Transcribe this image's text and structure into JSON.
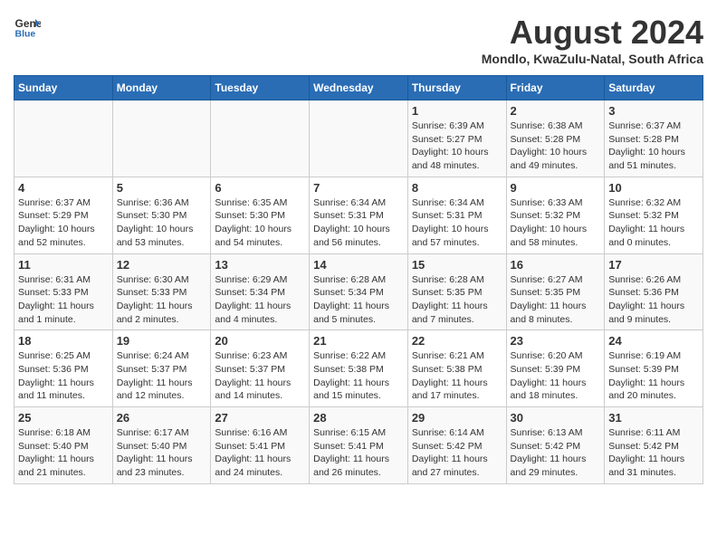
{
  "header": {
    "logo_line1": "General",
    "logo_line2": "Blue",
    "month_title": "August 2024",
    "location": "Mondlo, KwaZulu-Natal, South Africa"
  },
  "days_of_week": [
    "Sunday",
    "Monday",
    "Tuesday",
    "Wednesday",
    "Thursday",
    "Friday",
    "Saturday"
  ],
  "weeks": [
    [
      {
        "num": "",
        "info": ""
      },
      {
        "num": "",
        "info": ""
      },
      {
        "num": "",
        "info": ""
      },
      {
        "num": "",
        "info": ""
      },
      {
        "num": "1",
        "info": "Sunrise: 6:39 AM\nSunset: 5:27 PM\nDaylight: 10 hours\nand 48 minutes."
      },
      {
        "num": "2",
        "info": "Sunrise: 6:38 AM\nSunset: 5:28 PM\nDaylight: 10 hours\nand 49 minutes."
      },
      {
        "num": "3",
        "info": "Sunrise: 6:37 AM\nSunset: 5:28 PM\nDaylight: 10 hours\nand 51 minutes."
      }
    ],
    [
      {
        "num": "4",
        "info": "Sunrise: 6:37 AM\nSunset: 5:29 PM\nDaylight: 10 hours\nand 52 minutes."
      },
      {
        "num": "5",
        "info": "Sunrise: 6:36 AM\nSunset: 5:30 PM\nDaylight: 10 hours\nand 53 minutes."
      },
      {
        "num": "6",
        "info": "Sunrise: 6:35 AM\nSunset: 5:30 PM\nDaylight: 10 hours\nand 54 minutes."
      },
      {
        "num": "7",
        "info": "Sunrise: 6:34 AM\nSunset: 5:31 PM\nDaylight: 10 hours\nand 56 minutes."
      },
      {
        "num": "8",
        "info": "Sunrise: 6:34 AM\nSunset: 5:31 PM\nDaylight: 10 hours\nand 57 minutes."
      },
      {
        "num": "9",
        "info": "Sunrise: 6:33 AM\nSunset: 5:32 PM\nDaylight: 10 hours\nand 58 minutes."
      },
      {
        "num": "10",
        "info": "Sunrise: 6:32 AM\nSunset: 5:32 PM\nDaylight: 11 hours\nand 0 minutes."
      }
    ],
    [
      {
        "num": "11",
        "info": "Sunrise: 6:31 AM\nSunset: 5:33 PM\nDaylight: 11 hours\nand 1 minute."
      },
      {
        "num": "12",
        "info": "Sunrise: 6:30 AM\nSunset: 5:33 PM\nDaylight: 11 hours\nand 2 minutes."
      },
      {
        "num": "13",
        "info": "Sunrise: 6:29 AM\nSunset: 5:34 PM\nDaylight: 11 hours\nand 4 minutes."
      },
      {
        "num": "14",
        "info": "Sunrise: 6:28 AM\nSunset: 5:34 PM\nDaylight: 11 hours\nand 5 minutes."
      },
      {
        "num": "15",
        "info": "Sunrise: 6:28 AM\nSunset: 5:35 PM\nDaylight: 11 hours\nand 7 minutes."
      },
      {
        "num": "16",
        "info": "Sunrise: 6:27 AM\nSunset: 5:35 PM\nDaylight: 11 hours\nand 8 minutes."
      },
      {
        "num": "17",
        "info": "Sunrise: 6:26 AM\nSunset: 5:36 PM\nDaylight: 11 hours\nand 9 minutes."
      }
    ],
    [
      {
        "num": "18",
        "info": "Sunrise: 6:25 AM\nSunset: 5:36 PM\nDaylight: 11 hours\nand 11 minutes."
      },
      {
        "num": "19",
        "info": "Sunrise: 6:24 AM\nSunset: 5:37 PM\nDaylight: 11 hours\nand 12 minutes."
      },
      {
        "num": "20",
        "info": "Sunrise: 6:23 AM\nSunset: 5:37 PM\nDaylight: 11 hours\nand 14 minutes."
      },
      {
        "num": "21",
        "info": "Sunrise: 6:22 AM\nSunset: 5:38 PM\nDaylight: 11 hours\nand 15 minutes."
      },
      {
        "num": "22",
        "info": "Sunrise: 6:21 AM\nSunset: 5:38 PM\nDaylight: 11 hours\nand 17 minutes."
      },
      {
        "num": "23",
        "info": "Sunrise: 6:20 AM\nSunset: 5:39 PM\nDaylight: 11 hours\nand 18 minutes."
      },
      {
        "num": "24",
        "info": "Sunrise: 6:19 AM\nSunset: 5:39 PM\nDaylight: 11 hours\nand 20 minutes."
      }
    ],
    [
      {
        "num": "25",
        "info": "Sunrise: 6:18 AM\nSunset: 5:40 PM\nDaylight: 11 hours\nand 21 minutes."
      },
      {
        "num": "26",
        "info": "Sunrise: 6:17 AM\nSunset: 5:40 PM\nDaylight: 11 hours\nand 23 minutes."
      },
      {
        "num": "27",
        "info": "Sunrise: 6:16 AM\nSunset: 5:41 PM\nDaylight: 11 hours\nand 24 minutes."
      },
      {
        "num": "28",
        "info": "Sunrise: 6:15 AM\nSunset: 5:41 PM\nDaylight: 11 hours\nand 26 minutes."
      },
      {
        "num": "29",
        "info": "Sunrise: 6:14 AM\nSunset: 5:42 PM\nDaylight: 11 hours\nand 27 minutes."
      },
      {
        "num": "30",
        "info": "Sunrise: 6:13 AM\nSunset: 5:42 PM\nDaylight: 11 hours\nand 29 minutes."
      },
      {
        "num": "31",
        "info": "Sunrise: 6:11 AM\nSunset: 5:42 PM\nDaylight: 11 hours\nand 31 minutes."
      }
    ]
  ]
}
